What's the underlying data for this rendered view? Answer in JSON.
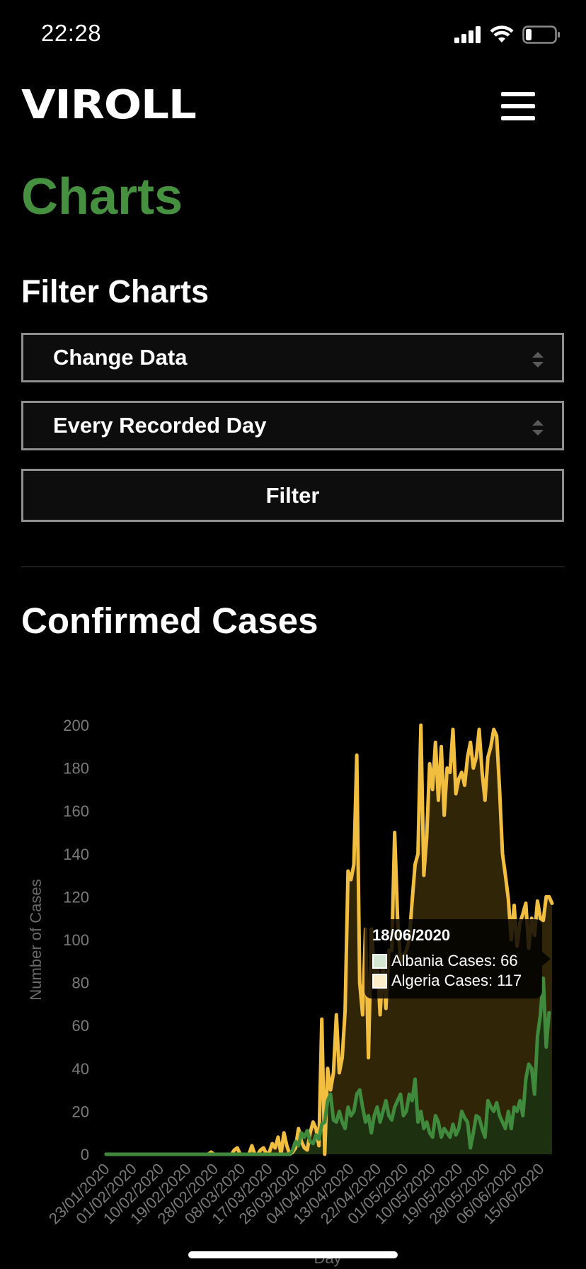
{
  "status_bar": {
    "time": "22:28"
  },
  "header": {
    "logo": "VIROLL"
  },
  "page": {
    "title": "Charts"
  },
  "filters": {
    "heading": "Filter Charts",
    "data_select": "Change Data",
    "period_select": "Every Recorded Day",
    "filter_button": "Filter"
  },
  "section": {
    "title": "Confirmed Cases"
  },
  "tooltip": {
    "date": "18/06/2020",
    "rows": [
      "Albania Cases: 66",
      "Algeria Cases: 117"
    ]
  },
  "colors": {
    "accent": "#46913f",
    "albania_line": "#3f8a3c",
    "algeria_line": "#f2be3f",
    "algeria_fill": "#3a2c08",
    "albania_fill": "#1a3312"
  },
  "chart_data": {
    "type": "line",
    "xlabel": "Day",
    "ylabel": "Number of Cases",
    "ylim": [
      0,
      200
    ],
    "yticks": [
      0,
      20,
      40,
      60,
      80,
      100,
      120,
      140,
      160,
      180,
      200
    ],
    "x_start": "23/01/2020",
    "x_end": "18/06/2020",
    "xticks": [
      "23/01/2020",
      "01/02/2020",
      "10/02/2020",
      "19/02/2020",
      "28/02/2020",
      "08/03/2020",
      "17/03/2020",
      "26/03/2020",
      "04/04/2020",
      "13/04/2020",
      "22/04/2020",
      "01/05/2020",
      "10/05/2020",
      "19/05/2020",
      "28/05/2020",
      "06/06/2020",
      "15/06/2020"
    ],
    "series": [
      {
        "name": "Algeria Cases",
        "color": "#f2be3f",
        "values": [
          0,
          0,
          0,
          0,
          0,
          0,
          0,
          0,
          0,
          0,
          0,
          0,
          0,
          0,
          0,
          0,
          0,
          0,
          0,
          0,
          0,
          0,
          0,
          0,
          0,
          0,
          0,
          0,
          0,
          0,
          0,
          0,
          0,
          0,
          0,
          0,
          1,
          0,
          0,
          0,
          0,
          0,
          0,
          0,
          2,
          3,
          0,
          0,
          0,
          0,
          4,
          0,
          0,
          2,
          3,
          0,
          1,
          5,
          3,
          8,
          0,
          10,
          4,
          0,
          1,
          3,
          12,
          6,
          3,
          2,
          10,
          15,
          12,
          4,
          63,
          0,
          40,
          30,
          38,
          65,
          38,
          45,
          67,
          132,
          128,
          135,
          186,
          80,
          65,
          105,
          45,
          105,
          85,
          92,
          65,
          90,
          68,
          95,
          95,
          150,
          110,
          90,
          92,
          95,
          100,
          118,
          135,
          140,
          200,
          130,
          148,
          182,
          170,
          192,
          165,
          190,
          158,
          180,
          178,
          198,
          168,
          175,
          178,
          172,
          185,
          192,
          180,
          185,
          198,
          178,
          165,
          185,
          190,
          198,
          195,
          170,
          140,
          130,
          119,
          100,
          116,
          97,
          108,
          112,
          117,
          96,
          110,
          102,
          118,
          110,
          109,
          120,
          120,
          117
        ]
      },
      {
        "name": "Albania Cases",
        "color": "#3f8a3c",
        "values": [
          0,
          0,
          0,
          0,
          0,
          0,
          0,
          0,
          0,
          0,
          0,
          0,
          0,
          0,
          0,
          0,
          0,
          0,
          0,
          0,
          0,
          0,
          0,
          0,
          0,
          0,
          0,
          0,
          0,
          0,
          0,
          0,
          0,
          0,
          0,
          0,
          0,
          0,
          0,
          0,
          0,
          0,
          0,
          0,
          0,
          0,
          0,
          0,
          0,
          0,
          0,
          0,
          0,
          0,
          0,
          0,
          0,
          0,
          0,
          0,
          0,
          0,
          0,
          0,
          2,
          6,
          4,
          10,
          8,
          11,
          6,
          5,
          9,
          7,
          14,
          15,
          25,
          28,
          16,
          15,
          20,
          15,
          12,
          22,
          18,
          20,
          28,
          30,
          22,
          15,
          18,
          10,
          18,
          22,
          15,
          20,
          25,
          18,
          16,
          22,
          25,
          28,
          18,
          20,
          28,
          25,
          35,
          15,
          20,
          12,
          15,
          10,
          8,
          18,
          15,
          8,
          12,
          10,
          8,
          14,
          9,
          12,
          20,
          17,
          15,
          3,
          10,
          18,
          17,
          12,
          8,
          25,
          22,
          20,
          24,
          18,
          15,
          12,
          20,
          12,
          22,
          20,
          25,
          18,
          35,
          42,
          40,
          28,
          55,
          65,
          82,
          50,
          66
        ]
      }
    ],
    "tooltip_index": 149
  }
}
